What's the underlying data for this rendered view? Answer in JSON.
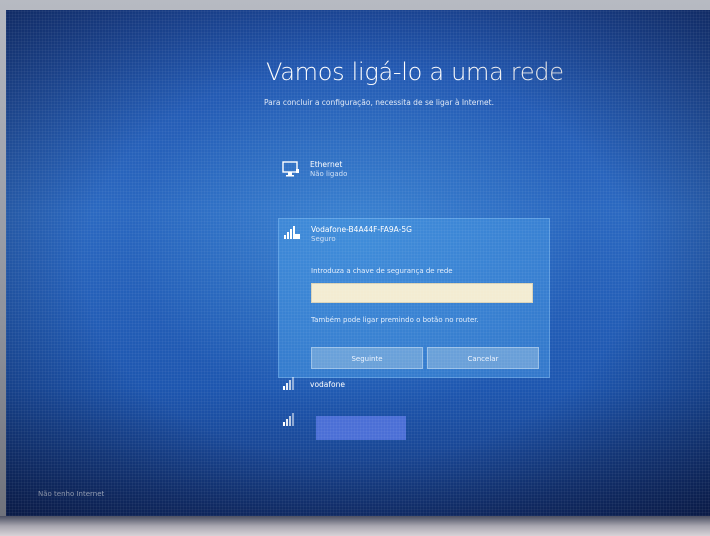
{
  "setup": {
    "title": "Vamos ligá-lo a uma rede",
    "subtitle": "Para concluir a configuração, necessita de se ligar à Internet."
  },
  "networks": [
    {
      "name": "Ethernet",
      "status": "Não ligado",
      "icon": "ethernet-monitor-icon"
    },
    {
      "name": "Vodafone-B4A44F-FA9A-5G",
      "status": "Seguro",
      "icon": "wifi-secured-icon",
      "key_label": "Introduza a chave de segurança de rede",
      "key_value": "",
      "wps_text": "Também pode ligar premindo o botão no router.",
      "next_label": "Seguinte",
      "cancel_label": "Cancelar"
    },
    {
      "name": "vodafone",
      "icon": "wifi-icon"
    },
    {
      "name": "",
      "icon": "wifi-icon"
    }
  ],
  "footer": {
    "skip_label": "Não tenho Internet"
  },
  "colors": {
    "screen_blue": "#2e6cc4",
    "input_bg": "#f3ecd2",
    "redaction": "#4b6fd6"
  }
}
